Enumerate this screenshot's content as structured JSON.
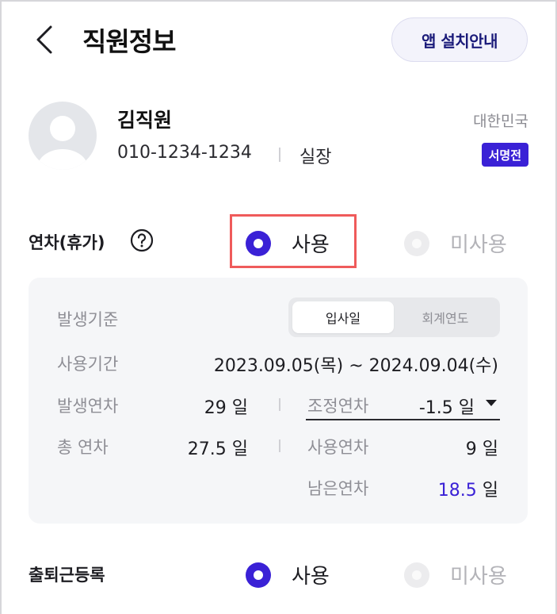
{
  "header": {
    "title": "직원정보",
    "install_button": "앱 설치안내"
  },
  "profile": {
    "name": "김직원",
    "phone": "010-1234-1234",
    "rank": "실장",
    "country": "대한민국",
    "sign_badge": "서명전"
  },
  "annual_leave": {
    "label": "연차(휴가)",
    "use_label": "사용",
    "unused_label": "미사용",
    "selected": "사용",
    "basis_label": "발생기준",
    "basis_options": [
      "입사일",
      "회계연도"
    ],
    "basis_selected": "입사일",
    "period_label": "사용기간",
    "period_value": "2023.09.05(목) ~ 2024.09.04(수)",
    "occurred_label": "발생연차",
    "occurred_value": "29",
    "adjust_label": "조정연차",
    "adjust_value": "-1.5",
    "total_label": "총 연차",
    "total_value": "27.5",
    "used_label": "사용연차",
    "used_value": "9",
    "remaining_label": "남은연차",
    "remaining_value": "18.5",
    "unit": "일"
  },
  "attendance": {
    "label": "출퇴근등록",
    "use_label": "사용",
    "unused_label": "미사용",
    "selected": "사용"
  },
  "colors": {
    "accent": "#3a21d6",
    "highlight": "#ef5b5b"
  }
}
